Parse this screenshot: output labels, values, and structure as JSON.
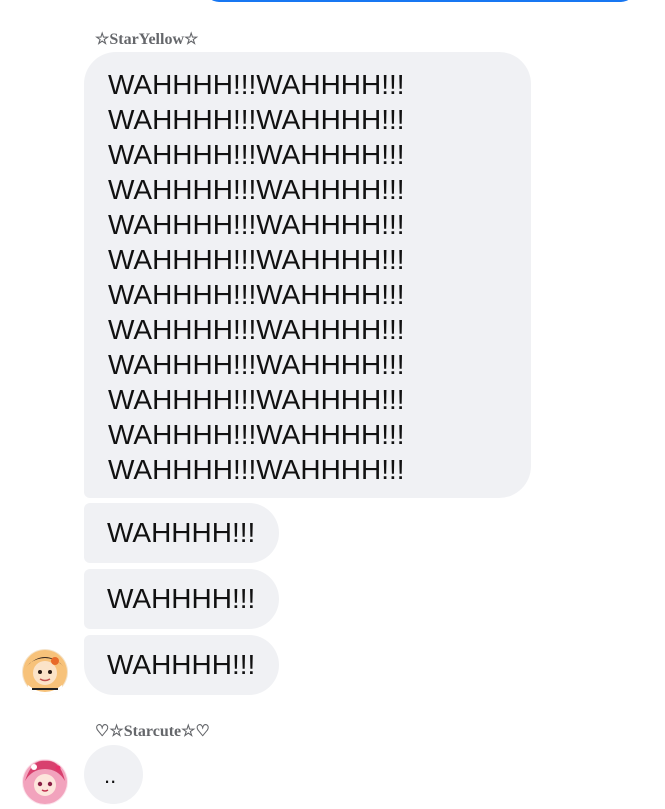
{
  "thread": {
    "group1": {
      "sender": "☆StarYellow☆",
      "multi_lines": [
        "WAHHHH!!!WAHHHH!!!",
        "WAHHHH!!!WAHHHH!!!",
        "WAHHHH!!!WAHHHH!!!",
        "WAHHHH!!!WAHHHH!!!",
        "WAHHHH!!!WAHHHH!!!",
        "WAHHHH!!!WAHHHH!!!",
        "WAHHHH!!!WAHHHH!!!",
        "WAHHHH!!!WAHHHH!!!",
        "WAHHHH!!!WAHHHH!!!",
        "WAHHHH!!!WAHHHH!!!",
        "WAHHHH!!!WAHHHH!!!",
        "WAHHHH!!!WAHHHH!!!"
      ],
      "short_messages": [
        "WAHHHH!!!",
        "WAHHHH!!!",
        "WAHHHH!!!"
      ],
      "avatar_icon": "cartoon-character-avatar"
    },
    "group2": {
      "sender": "♡☆Starcute☆♡",
      "message": "..",
      "avatar_icon": "pink-character-avatar"
    }
  },
  "colors": {
    "bubble_bg": "#f0f1f4",
    "outgoing_bubble": "#1877f2",
    "sender_name": "#65676b"
  }
}
